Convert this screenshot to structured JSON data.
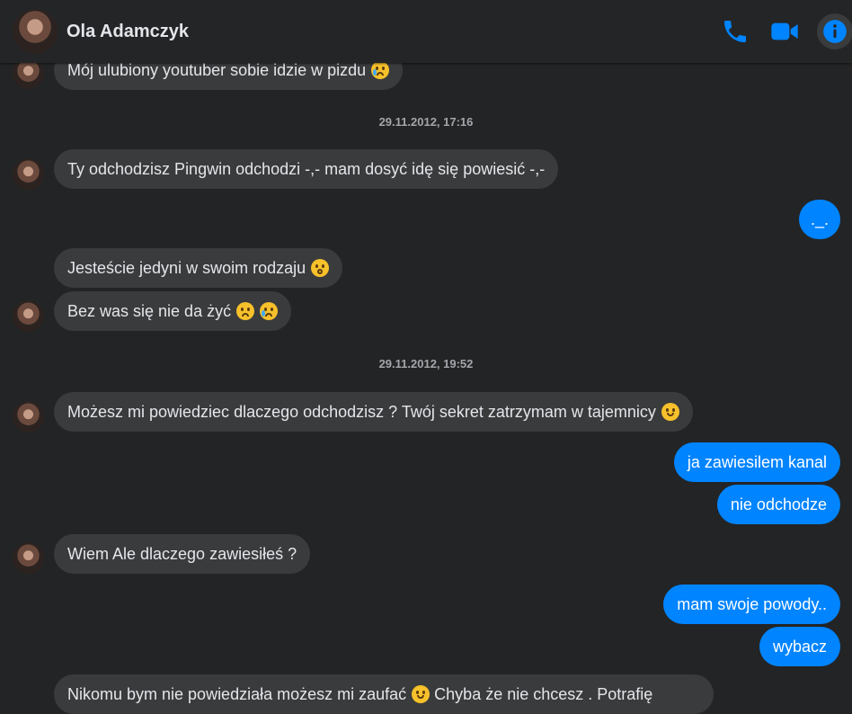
{
  "contact": {
    "name": "Ola Adamczyk"
  },
  "header_icons": [
    "phone-icon",
    "video-icon",
    "info-icon"
  ],
  "colors": {
    "accent": "#0084ff",
    "background": "#232425",
    "incoming_bubble": "#3a3b3c"
  },
  "messages": {
    "m1": "Mój ulubiony youtuber sobie idzie w pizdu",
    "ts1": "29.11.2012, 17:16",
    "m2": "Ty odchodzisz Pingwin odchodzi -,- mam dosyć idę się powiesić -,-",
    "m3": "._.",
    "m4": "Jesteście jedyni w swoim rodzaju",
    "m5": "Bez was się nie da żyć",
    "ts2": "29.11.2012, 19:52",
    "m6": "Możesz mi powiedziec dlaczego odchodzisz ? Twój sekret zatrzymam w tajemnicy",
    "m7": "ja zawiesilem kanal",
    "m8": "nie odchodze",
    "m9": "Wiem Ale dlaczego zawiesiłeś ?",
    "m10": "mam swoje powody..",
    "m11": "wybacz",
    "m12": "Nikomu bym nie powiedziała możesz mi zaufać",
    "m12b": "Chyba że nie chcesz . Potrafię"
  }
}
